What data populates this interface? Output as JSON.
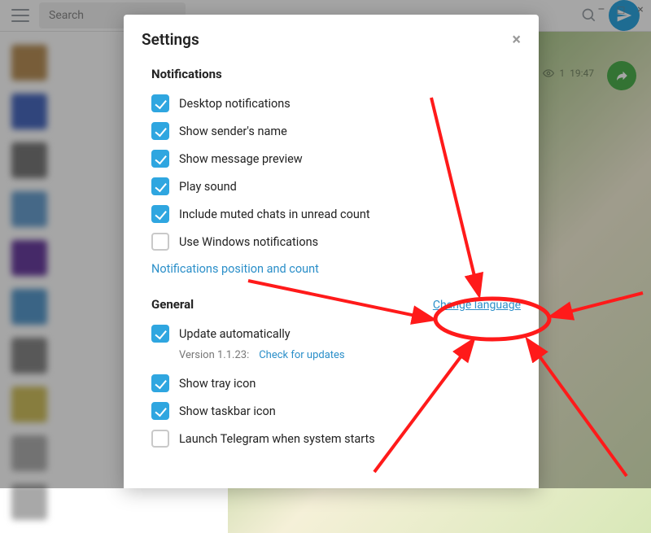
{
  "window": {
    "min": "–",
    "max": "□",
    "close": "×"
  },
  "topbar": {
    "search_placeholder": "Search"
  },
  "msg": {
    "views": "1",
    "time": "19:47"
  },
  "modal": {
    "title": "Settings",
    "sections": {
      "notifications": {
        "title": "Notifications",
        "items": [
          {
            "label": "Desktop notifications",
            "checked": true
          },
          {
            "label": "Show sender's name",
            "checked": true
          },
          {
            "label": "Show message preview",
            "checked": true
          },
          {
            "label": "Play sound",
            "checked": true
          },
          {
            "label": "Include muted chats in unread count",
            "checked": true
          },
          {
            "label": "Use Windows notifications",
            "checked": false
          }
        ],
        "footer_link": "Notifications position and count"
      },
      "general": {
        "title": "General",
        "header_link": "Change language",
        "items": [
          {
            "label": "Update automatically",
            "checked": true,
            "sub_prefix": "Version 1.1.23: ",
            "sub_link": "Check for updates"
          },
          {
            "label": "Show tray icon",
            "checked": true
          },
          {
            "label": "Show taskbar icon",
            "checked": true
          },
          {
            "label": "Launch Telegram when system starts",
            "checked": false
          }
        ]
      }
    }
  },
  "avatars": [
    "#b89058",
    "#4a6abf",
    "#7a7a7a",
    "#6aa0cf",
    "#6b3fa0",
    "#5a9acc",
    "#888",
    "#d0c060",
    "#b0b0b0",
    "#a8a8a8"
  ]
}
